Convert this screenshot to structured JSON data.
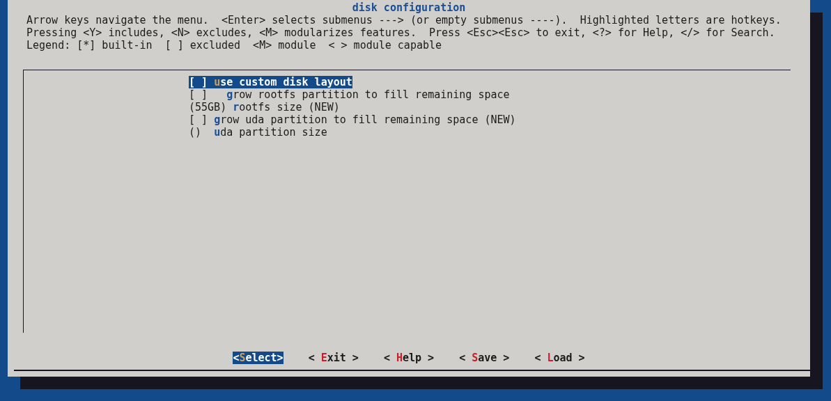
{
  "dialog": {
    "title": "disk configuration",
    "help_lines": [
      "Arrow keys navigate the menu.  <Enter> selects submenus ---> (or empty submenus ----).  Highlighted letters are hotkeys.",
      "Pressing <Y> includes, <N> excludes, <M> modularizes features.  Press <Esc><Esc> to exit, <?> for Help, </> for Search.",
      "Legend: [*] built-in  [ ] excluded  <M> module  < > module capable"
    ]
  },
  "menu": {
    "items": [
      {
        "prefix": "[ ] ",
        "label": "use custom disk layout",
        "selected": true
      },
      {
        "prefix": "[ ]   ",
        "label": "grow rootfs partition to fill remaining space",
        "selected": false
      },
      {
        "prefix": "(55GB) ",
        "label": "rootfs size (NEW)",
        "selected": false
      },
      {
        "prefix": "[ ] ",
        "label": "grow uda partition to fill remaining space (NEW)",
        "selected": false
      },
      {
        "prefix": "()  ",
        "label": "uda partition size",
        "selected": false
      }
    ]
  },
  "buttons": [
    {
      "text": "<Select>",
      "selected": true
    },
    {
      "text": "< Exit >",
      "selected": false
    },
    {
      "text": "< Help >",
      "selected": false
    },
    {
      "text": "< Save >",
      "selected": false
    },
    {
      "text": "< Load >",
      "selected": false
    }
  ]
}
